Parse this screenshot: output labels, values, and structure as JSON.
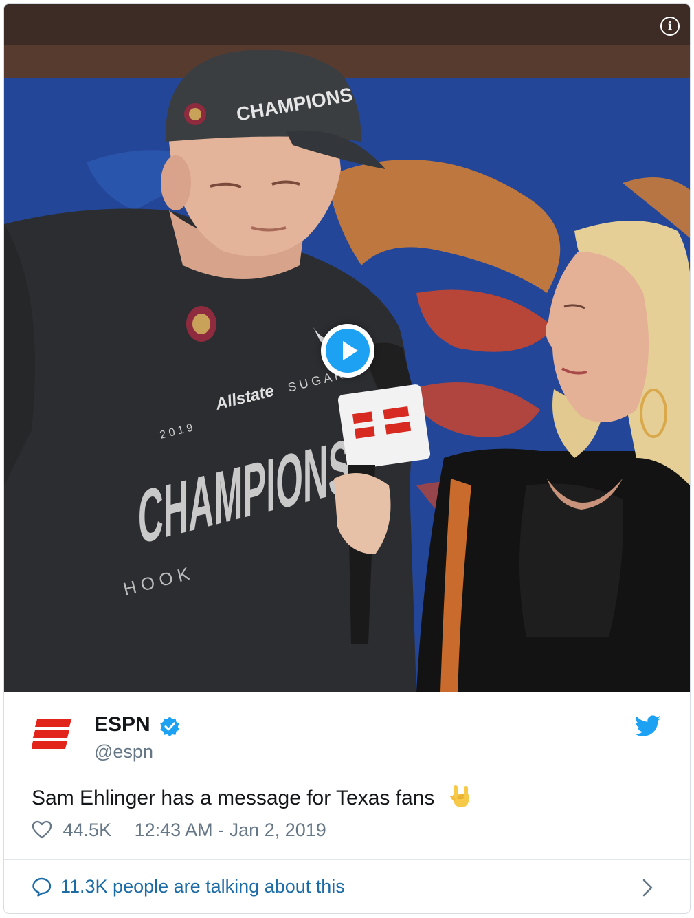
{
  "tweet": {
    "author": {
      "name": "ESPN",
      "handle": "@espn",
      "verified": true,
      "avatar_icon": "espn-logo-icon"
    },
    "text": "Sam Ehlinger has a message for Texas fans",
    "text_emoji": "horns-hand-emoji",
    "likes": "44.5K",
    "timestamp": "12:43 AM - Jan 2, 2019",
    "talking": "11.3K people are talking about this"
  },
  "media": {
    "type": "video",
    "play_icon": "play-icon",
    "info_icon": "info-icon",
    "info_glyph": "i",
    "cap_text": "CHAMPIONS",
    "shirt_brand": "Allstate",
    "shirt_year": "2 0 1 9",
    "shirt_sugar": "S U G A R",
    "shirt_title": "CHAMPIONS",
    "shirt_hook": "H O O K"
  },
  "colors": {
    "accent": "#1da1f2",
    "verified": "#1da1f2",
    "espn_red": "#e1251b",
    "link": "#1b6ba6",
    "secondary_text": "#657786",
    "primary_text": "#14171a"
  }
}
